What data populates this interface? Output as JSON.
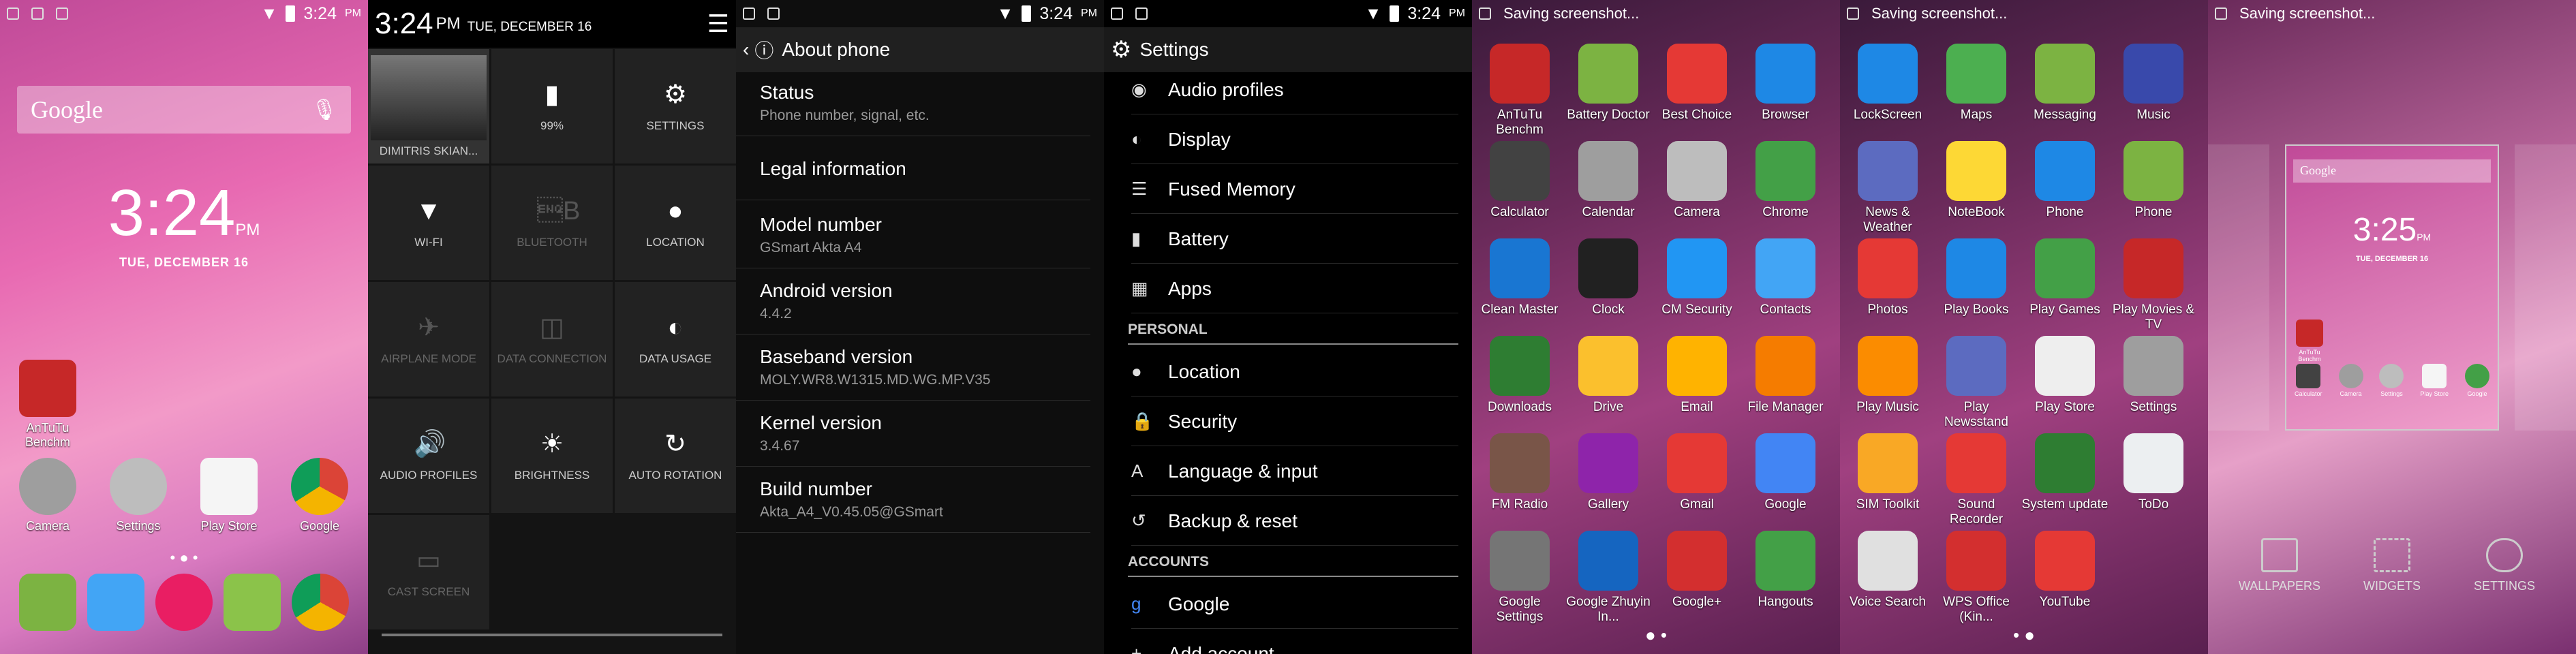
{
  "home": {
    "status_time": "3:24",
    "status_ampm": "PM",
    "search_text": "Google",
    "clock": "3:24",
    "clock_ampm": "PM",
    "date": "TUE, DECEMBER 16",
    "apps": [
      {
        "label": "AnTuTu Benchm",
        "icon": "antutu-icon"
      },
      {
        "label": "Camera",
        "icon": "camera-icon"
      },
      {
        "label": "Settings",
        "icon": "settings-icon"
      },
      {
        "label": "Play Store",
        "icon": "play-store-icon"
      },
      {
        "label": "Google",
        "icon": "google-icon"
      }
    ],
    "dock": [
      "phone-icon",
      "contacts-icon",
      "app-drawer-icon",
      "messaging-icon",
      "chrome-icon"
    ]
  },
  "quick": {
    "time": "3:24",
    "ampm": "PM",
    "date": "TUE, DECEMBER 16",
    "tiles": [
      {
        "label": "DIMITRIS SKIAN...",
        "icon": "user-photo-icon"
      },
      {
        "label": "99%",
        "icon": "battery-icon"
      },
      {
        "label": "SETTINGS",
        "icon": "gear-icon"
      },
      {
        "label": "WI-FI",
        "icon": "wifi-icon"
      },
      {
        "label": "BLUETOOTH",
        "icon": "bluetooth-icon"
      },
      {
        "label": "LOCATION",
        "icon": "location-icon"
      },
      {
        "label": "AIRPLANE MODE",
        "icon": "airplane-icon"
      },
      {
        "label": "DATA CONNECTION",
        "icon": "data-icon"
      },
      {
        "label": "DATA USAGE",
        "icon": "data-usage-icon"
      },
      {
        "label": "AUDIO PROFILES",
        "icon": "audio-icon"
      },
      {
        "label": "BRIGHTNESS",
        "icon": "brightness-icon"
      },
      {
        "label": "AUTO ROTATION",
        "icon": "rotation-icon"
      },
      {
        "label": "CAST SCREEN",
        "icon": "cast-icon"
      }
    ]
  },
  "about": {
    "title": "About phone",
    "time": "3:24",
    "ampm": "PM",
    "rows": [
      {
        "label": "Status",
        "sub": "Phone number, signal, etc."
      },
      {
        "label": "Legal information",
        "sub": ""
      },
      {
        "label": "Model number",
        "sub": "GSmart Akta A4"
      },
      {
        "label": "Android version",
        "sub": "4.4.2"
      },
      {
        "label": "Baseband version",
        "sub": "MOLY.WR8.W1315.MD.WG.MP.V35"
      },
      {
        "label": "Kernel version",
        "sub": "3.4.67"
      },
      {
        "label": "Build number",
        "sub": "Akta_A4_V0.45.05@GSmart"
      }
    ]
  },
  "settings": {
    "title": "Settings",
    "time": "3:24",
    "ampm": "PM",
    "rows": [
      {
        "label": "Audio profiles",
        "icon": "audio-icon"
      },
      {
        "label": "Display",
        "icon": "display-icon"
      },
      {
        "label": "Fused Memory",
        "icon": "memory-icon"
      },
      {
        "label": "Battery",
        "icon": "battery-icon"
      },
      {
        "label": "Apps",
        "icon": "apps-icon"
      }
    ],
    "personal_header": "PERSONAL",
    "personal": [
      {
        "label": "Location",
        "icon": "location-icon"
      },
      {
        "label": "Security",
        "icon": "lock-icon"
      },
      {
        "label": "Language & input",
        "icon": "language-icon"
      },
      {
        "label": "Backup & reset",
        "icon": "backup-icon"
      }
    ],
    "accounts_header": "ACCOUNTS",
    "accounts": [
      {
        "label": "Google",
        "icon": "google-icon"
      },
      {
        "label": "Add account",
        "icon": "add-icon"
      }
    ]
  },
  "drawer1": {
    "status": "Saving screenshot...",
    "apps": [
      {
        "label": "AnTuTu Benchm",
        "color": "#c62828"
      },
      {
        "label": "Battery Doctor",
        "color": "#7cb342"
      },
      {
        "label": "Best Choice",
        "color": "#e53935"
      },
      {
        "label": "Browser",
        "color": "#1e88e5"
      },
      {
        "label": "Calculator",
        "color": "#424242"
      },
      {
        "label": "Calendar",
        "color": "#9e9e9e"
      },
      {
        "label": "Camera",
        "color": "#bdbdbd"
      },
      {
        "label": "Chrome",
        "color": "#43a047"
      },
      {
        "label": "Clean Master",
        "color": "#1976d2"
      },
      {
        "label": "Clock",
        "color": "#212121"
      },
      {
        "label": "CM Security",
        "color": "#2196f3"
      },
      {
        "label": "Contacts",
        "color": "#42a5f5"
      },
      {
        "label": "Downloads",
        "color": "#2e7d32"
      },
      {
        "label": "Drive",
        "color": "#fbc02d"
      },
      {
        "label": "Email",
        "color": "#ffb300"
      },
      {
        "label": "File Manager",
        "color": "#f57c00"
      },
      {
        "label": "FM Radio",
        "color": "#795548"
      },
      {
        "label": "Gallery",
        "color": "#8e24aa"
      },
      {
        "label": "Gmail",
        "color": "#e53935"
      },
      {
        "label": "Google",
        "color": "#4285f4"
      },
      {
        "label": "Google Settings",
        "color": "#757575"
      },
      {
        "label": "Google Zhuyin In...",
        "color": "#1565c0"
      },
      {
        "label": "Google+",
        "color": "#d32f2f"
      },
      {
        "label": "Hangouts",
        "color": "#43a047"
      }
    ]
  },
  "drawer2": {
    "status": "Saving screenshot...",
    "apps": [
      {
        "label": "LockScreen",
        "color": "#1e88e5"
      },
      {
        "label": "Maps",
        "color": "#4caf50"
      },
      {
        "label": "Messaging",
        "color": "#7cb342"
      },
      {
        "label": "Music",
        "color": "#3949ab"
      },
      {
        "label": "News & Weather",
        "color": "#5c6bc0"
      },
      {
        "label": "NoteBook",
        "color": "#fdd835"
      },
      {
        "label": "Phone",
        "color": "#1e88e5"
      },
      {
        "label": "Phone",
        "color": "#7cb342"
      },
      {
        "label": "Photos",
        "color": "#e53935"
      },
      {
        "label": "Play Books",
        "color": "#1e88e5"
      },
      {
        "label": "Play Games",
        "color": "#43a047"
      },
      {
        "label": "Play Movies & TV",
        "color": "#c62828"
      },
      {
        "label": "Play Music",
        "color": "#fb8c00"
      },
      {
        "label": "Play Newsstand",
        "color": "#5c6bc0"
      },
      {
        "label": "Play Store",
        "color": "#eeeeee"
      },
      {
        "label": "Settings",
        "color": "#9e9e9e"
      },
      {
        "label": "SIM Toolkit",
        "color": "#f9a825"
      },
      {
        "label": "Sound Recorder",
        "color": "#e53935"
      },
      {
        "label": "System update",
        "color": "#2e7d32"
      },
      {
        "label": "ToDo",
        "color": "#eceff1"
      },
      {
        "label": "Voice Search",
        "color": "#e0e0e0"
      },
      {
        "label": "WPS Office (Kin...",
        "color": "#d32f2f"
      },
      {
        "label": "YouTube",
        "color": "#e53935"
      }
    ]
  },
  "overview": {
    "status": "Saving screenshot...",
    "mini_search": "Google",
    "mini_clock": "3:25",
    "mini_ampm": "PM",
    "mini_date": "TUE, DECEMBER 16",
    "mini_apps": [
      "AnTuTu Benchm",
      "Calculator",
      "Camera",
      "Settings",
      "Play Store",
      "Google"
    ],
    "options": [
      {
        "label": "WALLPAPERS",
        "icon": "wallpapers-icon"
      },
      {
        "label": "WIDGETS",
        "icon": "widgets-icon"
      },
      {
        "label": "SETTINGS",
        "icon": "settings-gear-icon"
      }
    ]
  }
}
